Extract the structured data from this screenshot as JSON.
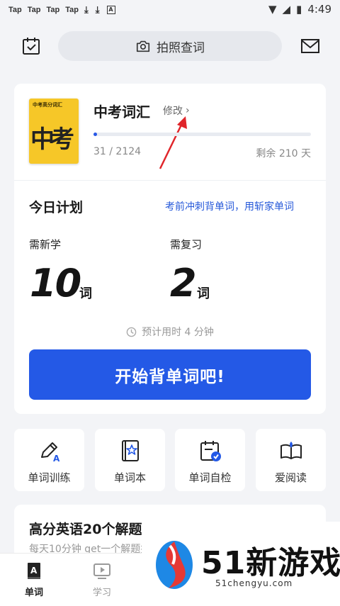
{
  "status_bar": {
    "notifications": [
      "Tap",
      "Tap",
      "Tap",
      "Tap"
    ],
    "time": "4:49"
  },
  "header": {
    "search_label": "拍照查词"
  },
  "book": {
    "cover_small_title": "中考高分词汇",
    "cover_big_text": "中考",
    "title": "中考词汇",
    "edit_label": "修改",
    "progress_current": 31,
    "progress_total": 2124,
    "progress_text": "31 / 2124",
    "remaining_text": "剩余 210 天"
  },
  "plan": {
    "title": "今日计划",
    "link_text": "考前冲刺背单词，用斩家单词",
    "new_label": "需新学",
    "new_count": "10",
    "review_label": "需复习",
    "review_count": "2",
    "unit": "词",
    "estimate_text": "预计用时 4 分钟",
    "start_button": "开始背单词吧!"
  },
  "tiles": [
    {
      "label": "单词训练",
      "icon": "pencil-icon"
    },
    {
      "label": "单词本",
      "icon": "star-book-icon"
    },
    {
      "label": "单词自检",
      "icon": "calendar-check-icon"
    },
    {
      "label": "爱阅读",
      "icon": "open-book-icon"
    }
  ],
  "promo": {
    "title": "高分英语20个解题技巧",
    "subtitle": "每天10分钟 get一个解题技巧"
  },
  "tabbar": [
    {
      "label": "单词",
      "active": true
    },
    {
      "label": "学习",
      "active": false
    }
  ],
  "watermark": {
    "brand": "51新游戏",
    "domain": "51chengyu.com"
  },
  "colors": {
    "accent": "#2459e6",
    "background": "#f3f4f7",
    "book_cover": "#f6c728"
  }
}
